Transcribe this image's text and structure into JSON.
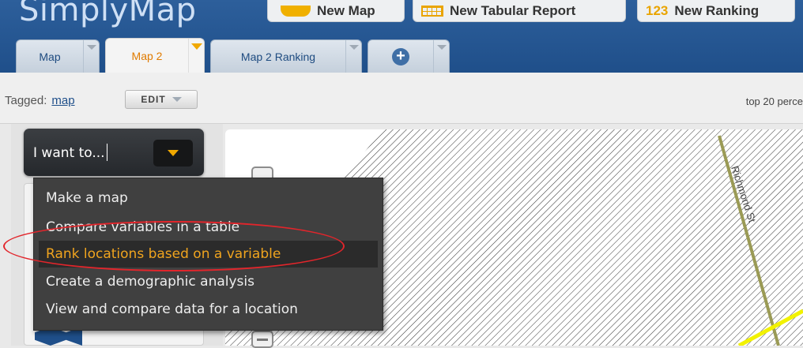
{
  "app": {
    "logo": "SimplyMap"
  },
  "top_buttons": [
    {
      "label": "New Map",
      "icon": "map-icon"
    },
    {
      "label": "New Tabular Report",
      "icon": "table-icon"
    },
    {
      "label": "New Ranking",
      "icon_text": "123"
    }
  ],
  "tabs": [
    {
      "label": "Map",
      "active": false
    },
    {
      "label": "Map 2",
      "active": true
    },
    {
      "label": "Map 2 Ranking",
      "active": false
    },
    {
      "label": "+",
      "active": false
    }
  ],
  "tag_bar": {
    "tagged_label": "Tagged:",
    "tag_link": "map",
    "edit_label": "EDIT",
    "right_note": "top 20 perce"
  },
  "i_want_to": {
    "label": "I want to..."
  },
  "menu": {
    "items": [
      {
        "label": "Make a map",
        "highlighted": false
      },
      {
        "label": "Compare variables in a table",
        "highlighted": false
      },
      {
        "label": "Rank locations based on a variable",
        "highlighted": true
      },
      {
        "label": "Create a demographic analysis",
        "highlighted": false
      },
      {
        "label": "View and compare data for a location",
        "highlighted": false
      }
    ]
  },
  "map": {
    "street_label": "Richmond St"
  },
  "colors": {
    "header": "#1f4f8a",
    "accent": "#f0a41e",
    "annotation": "#e2252b",
    "road": "#9a9a55",
    "road_highlight": "#f2f200"
  }
}
